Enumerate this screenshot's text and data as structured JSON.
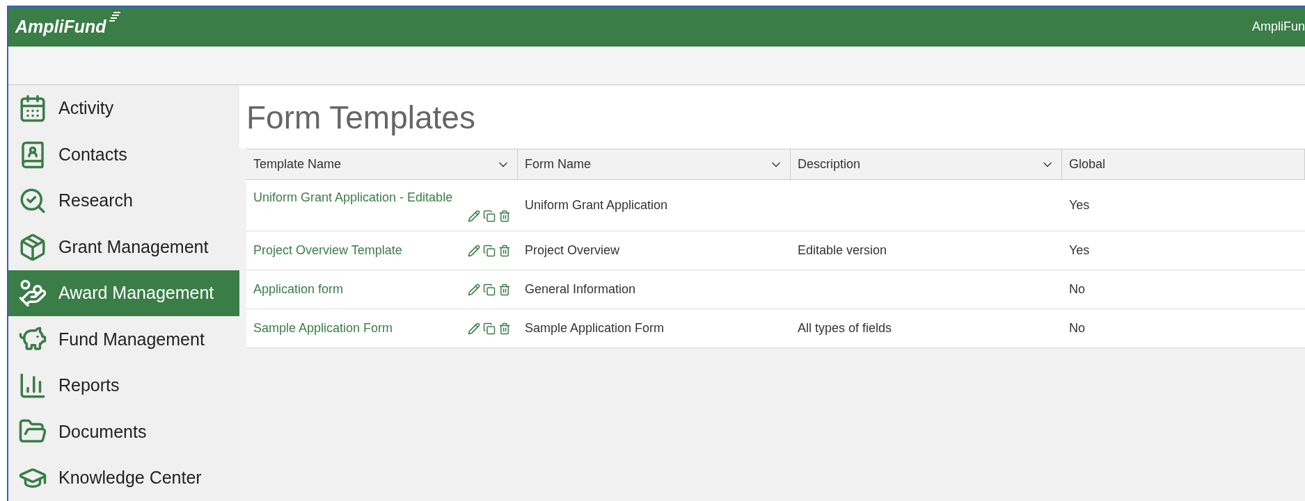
{
  "header": {
    "logo": "AmpliFund",
    "account": "AmpliFun"
  },
  "sidebar": {
    "items": [
      {
        "label": "Activity",
        "selected": false
      },
      {
        "label": "Contacts",
        "selected": false
      },
      {
        "label": "Research",
        "selected": false
      },
      {
        "label": "Grant Management",
        "selected": false
      },
      {
        "label": "Award Management",
        "selected": true
      },
      {
        "label": "Fund Management",
        "selected": false
      },
      {
        "label": "Reports",
        "selected": false
      },
      {
        "label": "Documents",
        "selected": false
      },
      {
        "label": "Knowledge Center",
        "selected": false
      }
    ]
  },
  "page": {
    "title": "Form Templates"
  },
  "table": {
    "columns": [
      {
        "label": "Template Name",
        "sortable": true
      },
      {
        "label": "Form Name",
        "sortable": true
      },
      {
        "label": "Description",
        "sortable": true
      },
      {
        "label": "Global",
        "sortable": false
      }
    ],
    "rows": [
      {
        "template_name": "Uniform Grant Application - Editable",
        "form_name": "Uniform Grant Application",
        "global": "Yes"
      },
      {
        "template_name": "Project Overview Template",
        "form_name": "Project Overview",
        "description": "Editable version",
        "global": "Yes"
      },
      {
        "template_name": "Application form",
        "form_name": "General Information",
        "global": "No"
      },
      {
        "template_name": "Sample Application Form",
        "form_name": "Sample Application Form",
        "description": "All types of fields",
        "global": "No"
      }
    ]
  }
}
